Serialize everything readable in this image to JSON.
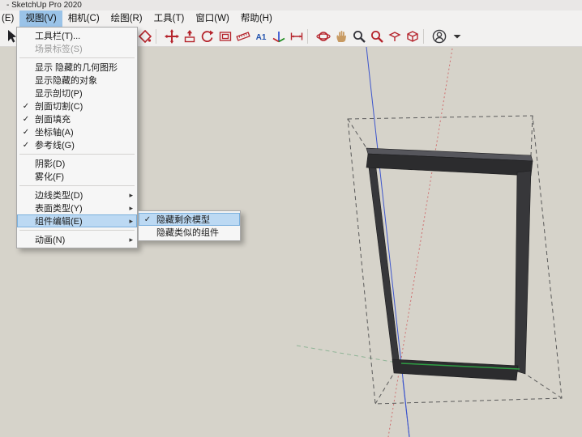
{
  "window": {
    "title": "- SketchUp Pro 2020"
  },
  "menubar": {
    "items": [
      {
        "label": "(E)"
      },
      {
        "label": "视图(V)",
        "active": true
      },
      {
        "label": "相机(C)"
      },
      {
        "label": "绘图(R)"
      },
      {
        "label": "工具(T)"
      },
      {
        "label": "窗口(W)"
      },
      {
        "label": "帮助(H)"
      }
    ]
  },
  "glyphs": {
    "check": "✓",
    "submenu_arrow": "▸"
  },
  "view_menu": {
    "items": [
      {
        "label": "工具栏(T)..."
      },
      {
        "label": "场景标签(S)",
        "disabled": true
      },
      {
        "separator": true
      },
      {
        "label": "显示 隐藏的几何图形"
      },
      {
        "label": "显示隐藏的对象"
      },
      {
        "label": "显示剖切(P)"
      },
      {
        "label": "剖面切割(C)",
        "checked": true
      },
      {
        "label": "剖面填充",
        "checked": true
      },
      {
        "label": "坐标轴(A)",
        "checked": true
      },
      {
        "label": "参考线(G)",
        "checked": true
      },
      {
        "separator": true
      },
      {
        "label": "阴影(D)"
      },
      {
        "label": "雾化(F)"
      },
      {
        "separator": true
      },
      {
        "label": "边线类型(D)",
        "submenu": true
      },
      {
        "label": "表面类型(Y)",
        "submenu": true
      },
      {
        "label": "组件编辑(E)",
        "submenu": true,
        "highlighted": true
      },
      {
        "separator": true
      },
      {
        "label": "动画(N)",
        "submenu": true
      }
    ]
  },
  "component_edit_submenu": {
    "items": [
      {
        "label": "隐藏剩余模型",
        "checked": true,
        "highlighted": true
      },
      {
        "label": "隐藏类似的组件",
        "checked": false
      }
    ]
  },
  "toolbar": {
    "icons": [
      {
        "name": "select-tool-button",
        "icon": "select-arrow-icon",
        "shape": "arrow",
        "color": "#222226"
      },
      {
        "name": "line-tool-button",
        "icon": "pencil-icon",
        "shape": "pencil",
        "color": "#b5242c"
      },
      {
        "name": "eraser-tool-button",
        "icon": "eraser-icon",
        "shape": "eraser",
        "color": "#b5242c"
      },
      {
        "separator": true
      },
      {
        "name": "rectangle-tool-button",
        "icon": "rectangle-icon",
        "shape": "rect",
        "color": "#b5242c"
      },
      {
        "name": "circle-tool-button",
        "icon": "circle-icon",
        "shape": "circle",
        "color": "#b5242c"
      },
      {
        "name": "arc-tool-button",
        "icon": "arc-icon",
        "shape": "arc",
        "color": "#b5242c"
      },
      {
        "name": "make-component-tool-button",
        "icon": "component-box-icon",
        "shape": "box",
        "color": "#b5242c"
      },
      {
        "name": "paint-bucket-tool-button",
        "icon": "paint-bucket-icon",
        "shape": "bucket",
        "color": "#b5242c"
      },
      {
        "separator": true
      },
      {
        "name": "move-tool-button",
        "icon": "move-cross-icon",
        "shape": "cross",
        "color": "#b5242c"
      },
      {
        "name": "push-pull-tool-button",
        "icon": "push-pull-icon",
        "shape": "pushpull",
        "color": "#b5242c"
      },
      {
        "name": "rotate-tool-button",
        "icon": "rotate-icon",
        "shape": "rotate",
        "color": "#b5242c"
      },
      {
        "name": "offset-tool-button",
        "icon": "offset-icon",
        "shape": "offset",
        "color": "#b5242c"
      },
      {
        "name": "tape-measure-tool-button",
        "icon": "ruler-icon",
        "shape": "ruler",
        "color": "#b5242c"
      },
      {
        "name": "text-tool-button",
        "icon": "text-a1-icon",
        "shape": "text",
        "color": "#2253ae",
        "label": "A1"
      },
      {
        "name": "axes-tool-button",
        "icon": "axes-icon",
        "shape": "axes",
        "color": "#b5242c"
      },
      {
        "name": "dimension-tool-button",
        "icon": "dimension-icon",
        "shape": "dimension",
        "color": "#b5242c"
      },
      {
        "separator": true
      },
      {
        "name": "orbit-tool-button",
        "icon": "orbit-icon",
        "shape": "orbit",
        "color": "#b5242c"
      },
      {
        "name": "pan-tool-button",
        "icon": "hand-icon",
        "shape": "hand",
        "color": "#c89a62"
      },
      {
        "name": "zoom-tool-button",
        "icon": "magnifier-icon",
        "shape": "magnifier",
        "color": "#33333a"
      },
      {
        "name": "zoom-extents-tool-button",
        "icon": "zoom-extents-icon",
        "shape": "magnifier",
        "color": "#b5242c"
      },
      {
        "name": "section-plane-tool-button",
        "icon": "section-plane-icon",
        "shape": "section",
        "color": "#b5242c"
      },
      {
        "name": "styles-tool-button",
        "icon": "styles-box-icon",
        "shape": "box",
        "color": "#b5242c"
      },
      {
        "separator": true
      },
      {
        "name": "account-button",
        "icon": "person-icon",
        "shape": "person",
        "color": "#3c3c40"
      },
      {
        "name": "toolbar-options-caret",
        "icon": "caret-down-icon",
        "shape": "caret",
        "color": "#333333"
      }
    ]
  },
  "viewport": {
    "background": "#d6d3ca",
    "axis_blue": "#3d55cc",
    "axis_red": "#cf7070",
    "axis_green": "#2f9e44",
    "axis_green_faint": "#8fb496",
    "selection_dash": "#5a5a5a",
    "model_face_dark": "#2c2c2e",
    "model_face_mid": "#37373a",
    "model_face_light": "#56565c"
  },
  "colors": {
    "menu_highlight": "#bcd9f3",
    "menubar_active": "#9ac3e8",
    "toolbar_red": "#b5242c"
  }
}
